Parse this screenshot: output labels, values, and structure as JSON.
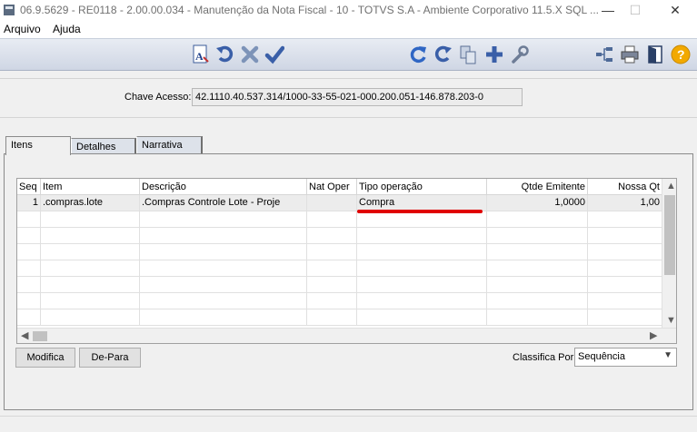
{
  "window": {
    "title": "06.9.5629 - RE0118 - 2.00.00.034 - Manutenção da Nota Fiscal - 10 - TOTVS S.A - Ambiente Corporativo 11.5.X SQL ...",
    "min": "—",
    "max": "☐",
    "close": "✕"
  },
  "menu": {
    "items": [
      "Arquivo",
      "Ajuda"
    ]
  },
  "toolbar": {
    "left_icons": [
      "text-format-icon",
      "undo-icon",
      "cancel-x-icon",
      "confirm-check-icon"
    ],
    "right_icons": [
      "refresh-icon",
      "redo-icon",
      "copy-icon",
      "add-plus-icon",
      "wrench-icon",
      "tree-icon",
      "print-icon",
      "exit-door-icon",
      "help-icon"
    ]
  },
  "key": {
    "label": "Chave Acesso:",
    "value": "42.1110.40.537.314/1000-33-55-021-000.200.051-146.878.203-0"
  },
  "tabs": [
    "Itens",
    "Detalhes",
    "Narrativa"
  ],
  "grid": {
    "columns": [
      "Seq",
      "Item",
      "Descrição",
      "Nat Oper",
      "Tipo operação",
      "Qtde Emitente",
      "Nossa Qt"
    ],
    "rows": [
      [
        "1",
        ".compras.lote",
        ".Compras Controle Lote - Proje",
        "",
        "Compra",
        "1,0000",
        "1,00"
      ]
    ]
  },
  "buttons": {
    "modifica": "Modifica",
    "de_para": "De-Para"
  },
  "classifica": {
    "label": "Classifica Por:",
    "value": "Sequência"
  },
  "colors": {
    "highlight_underline": "#e00000",
    "toolbar": "#d6dce8"
  }
}
